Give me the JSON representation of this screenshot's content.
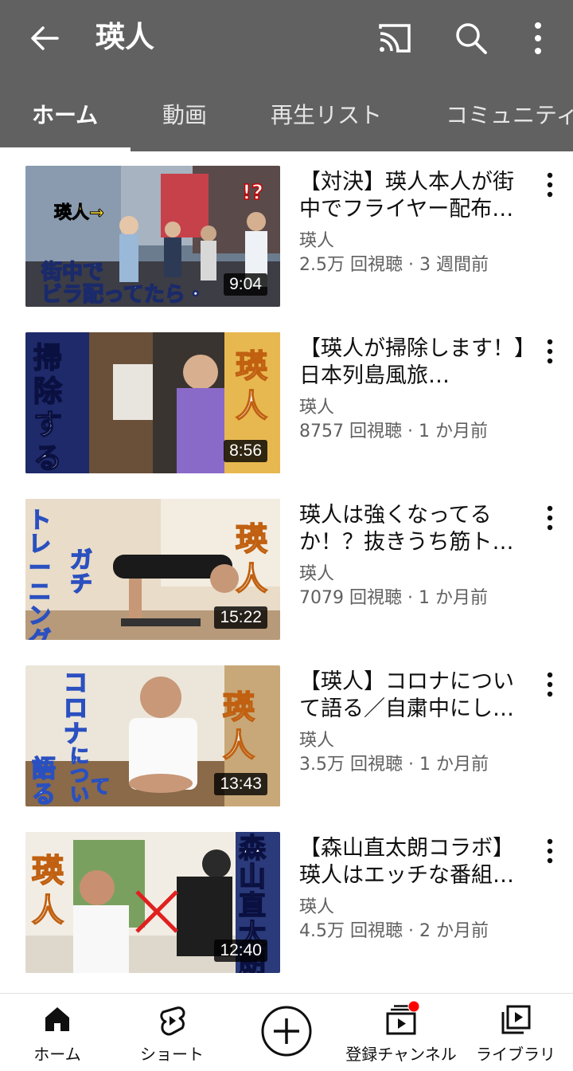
{
  "header": {
    "title": "瑛人",
    "back_icon": "arrow-left-icon",
    "cast_icon": "cast-icon",
    "search_icon": "search-icon",
    "more_icon": "more-vert-icon"
  },
  "tabs": [
    {
      "label": "ホーム",
      "active": true
    },
    {
      "label": "動画",
      "active": false
    },
    {
      "label": "再生リスト",
      "active": false
    },
    {
      "label": "コミュニティ",
      "active": false
    }
  ],
  "videos": [
    {
      "title": "【対決】瑛人本人が街中でフライヤー配布…",
      "channel": "瑛人",
      "meta": "2.5万 回視聴 · 3 週間前",
      "duration": "9:04",
      "thumb_text": [
        "瑛人→",
        "街中で",
        "ビラ配ってたら・"
      ],
      "thumb_badge": "!?"
    },
    {
      "title": "【瑛人が掃除します！】日本列島風旅…",
      "channel": "瑛人",
      "meta": "8757 回視聴 · 1 か月前",
      "duration": "8:56",
      "thumb_text": [
        "掃",
        "除",
        "す",
        "る",
        "瑛",
        "人"
      ]
    },
    {
      "title": "瑛人は強くなってるか！？抜きうち筋ト…",
      "channel": "瑛人",
      "meta": "7079 回視聴 · 1 か月前",
      "duration": "15:22",
      "thumb_text": [
        "ト",
        "レ",
        "ー",
        "ニ",
        "ン",
        "グ",
        "ガ",
        "チ",
        "瑛",
        "人"
      ]
    },
    {
      "title": "【瑛人】コロナについて語る／自粛中にし…",
      "channel": "瑛人",
      "meta": "3.5万 回視聴 · 1 か月前",
      "duration": "13:43",
      "thumb_text": [
        "コ",
        "ロ",
        "ナ",
        "に",
        "つ",
        "い",
        "て",
        "語",
        "る",
        "瑛",
        "人"
      ]
    },
    {
      "title": "【森山直太朗コラボ】瑛人はエッチな番組…",
      "channel": "瑛人",
      "meta": "4.5万 回視聴 · 2 か月前",
      "duration": "12:40",
      "thumb_text": [
        "瑛",
        "人",
        "森",
        "山",
        "直",
        "太",
        "朗"
      ]
    }
  ],
  "bottom_nav": [
    {
      "label": "ホーム",
      "icon": "home-icon"
    },
    {
      "label": "ショート",
      "icon": "shorts-icon"
    },
    {
      "label": "",
      "icon": "create-plus-icon"
    },
    {
      "label": "登録チャンネル",
      "icon": "subscriptions-icon",
      "badge": true
    },
    {
      "label": "ライブラリ",
      "icon": "library-icon"
    }
  ],
  "colors": {
    "appbar": "#616161",
    "badge": "#ff0000",
    "text_secondary": "#606060"
  }
}
